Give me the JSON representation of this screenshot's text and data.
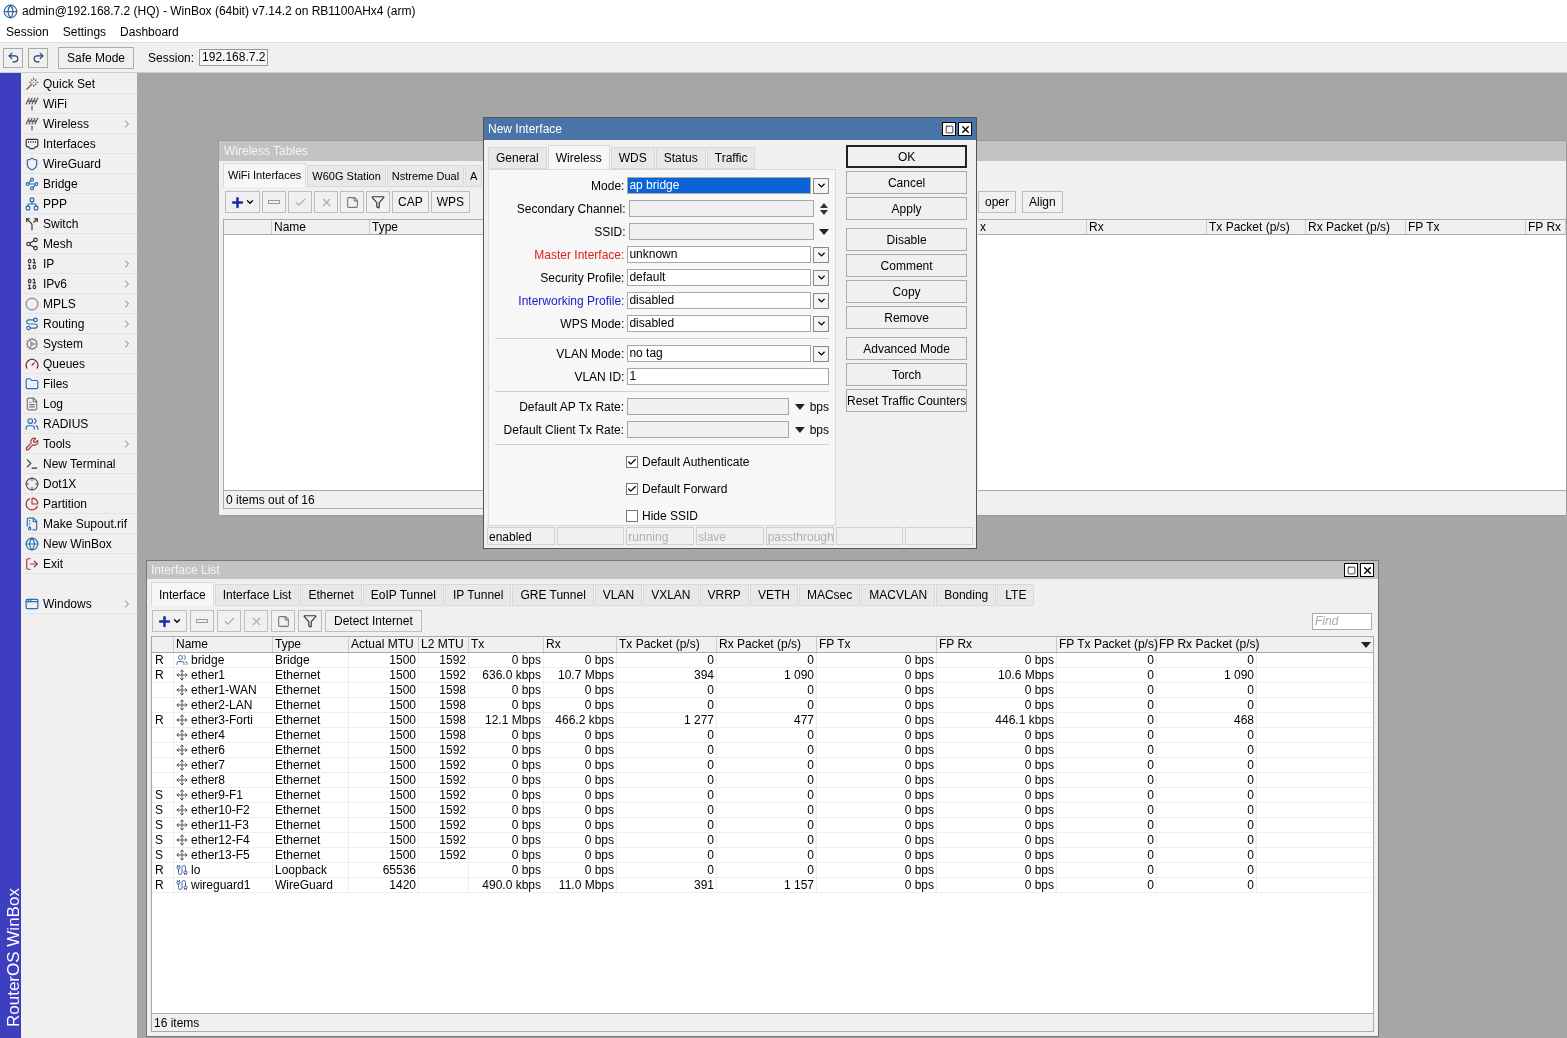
{
  "window": {
    "title": "admin@192.168.7.2 (HQ) - WinBox (64bit) v7.14.2 on RB1100AHx4 (arm)"
  },
  "menu": [
    "Session",
    "Settings",
    "Dashboard"
  ],
  "toolbar": {
    "safe_mode": "Safe Mode",
    "session_label": "Session:",
    "session_value": "192.168.7.2"
  },
  "sidebar": {
    "brand": "RouterOS WinBox",
    "items": [
      {
        "label": "Quick Set",
        "submenu": false
      },
      {
        "label": "WiFi",
        "submenu": false
      },
      {
        "label": "Wireless",
        "submenu": true
      },
      {
        "label": "Interfaces",
        "submenu": false
      },
      {
        "label": "WireGuard",
        "submenu": false
      },
      {
        "label": "Bridge",
        "submenu": false
      },
      {
        "label": "PPP",
        "submenu": false
      },
      {
        "label": "Switch",
        "submenu": false
      },
      {
        "label": "Mesh",
        "submenu": false
      },
      {
        "label": "IP",
        "submenu": true
      },
      {
        "label": "IPv6",
        "submenu": true
      },
      {
        "label": "MPLS",
        "submenu": true
      },
      {
        "label": "Routing",
        "submenu": true
      },
      {
        "label": "System",
        "submenu": true
      },
      {
        "label": "Queues",
        "submenu": false
      },
      {
        "label": "Files",
        "submenu": false
      },
      {
        "label": "Log",
        "submenu": false
      },
      {
        "label": "RADIUS",
        "submenu": false
      },
      {
        "label": "Tools",
        "submenu": true
      },
      {
        "label": "New Terminal",
        "submenu": false
      },
      {
        "label": "Dot1X",
        "submenu": false
      },
      {
        "label": "Partition",
        "submenu": false
      },
      {
        "label": "Make Supout.rif",
        "submenu": false
      },
      {
        "label": "New WinBox",
        "submenu": false
      },
      {
        "label": "Exit",
        "submenu": false
      }
    ],
    "bottom_items": [
      {
        "label": "Windows",
        "submenu": true
      }
    ]
  },
  "wireless_tables": {
    "title": "Wireless Tables",
    "tabs": [
      {
        "label": "WiFi Interfaces",
        "selected": true
      },
      {
        "label": "W60G Station",
        "selected": false
      },
      {
        "label": "Nstreme Dual",
        "selected": false
      },
      {
        "label": "A",
        "selected": false
      }
    ],
    "buttons": [
      "CAP",
      "WPS"
    ],
    "right_buttons": [
      "oper",
      "Align"
    ],
    "columns": [
      "Name",
      "Type"
    ],
    "right_columns": [
      "x",
      "Rx",
      "Tx Packet (p/s)",
      "Rx Packet (p/s)",
      "FP Tx",
      "FP Rx"
    ],
    "status": "0 items out of 16"
  },
  "dialog": {
    "title": "New Interface",
    "tabs": [
      {
        "label": "General",
        "selected": false
      },
      {
        "label": "Wireless",
        "selected": true
      },
      {
        "label": "WDS",
        "selected": false
      },
      {
        "label": "Status",
        "selected": false
      },
      {
        "label": "Traffic",
        "selected": false
      }
    ],
    "groups": [
      [
        {
          "kind": "dropdown",
          "label": "Mode:",
          "value": "ap bridge",
          "selected": true,
          "color": "#000000"
        },
        {
          "kind": "spin",
          "label": "Secondary Channel:",
          "selected": false,
          "color": "#000000"
        },
        {
          "kind": "combo",
          "label": "SSID:",
          "selected": false,
          "color": "#000000"
        },
        {
          "kind": "dropdown",
          "label": "Master Interface:",
          "value": "unknown",
          "selected": false,
          "color": "#e0201c"
        },
        {
          "kind": "dropdown",
          "label": "Security Profile:",
          "value": "default",
          "selected": false,
          "color": "#000000"
        },
        {
          "kind": "dropdown",
          "label": "Interworking Profile:",
          "value": "disabled",
          "selected": false,
          "color": "#2020c8"
        },
        {
          "kind": "dropdown",
          "label": "WPS Mode:",
          "value": "disabled",
          "selected": false,
          "color": "#000000"
        }
      ],
      [
        {
          "kind": "dropdown",
          "label": "VLAN Mode:",
          "value": "no tag",
          "selected": false,
          "color": "#000000"
        },
        {
          "kind": "text",
          "label": "VLAN ID:",
          "value": "1",
          "selected": false,
          "color": "#000000"
        }
      ],
      [
        {
          "kind": "rate",
          "label": "Default AP Tx Rate:",
          "unit": "bps",
          "selected": false,
          "color": "#000000"
        },
        {
          "kind": "rate",
          "label": "Default Client Tx Rate:",
          "unit": "bps",
          "selected": false,
          "color": "#000000"
        }
      ]
    ],
    "checkboxes": [
      {
        "label": "Default Authenticate",
        "checked": true
      },
      {
        "label": "Default Forward",
        "checked": true
      },
      {
        "label": "Hide SSID",
        "checked": false
      }
    ],
    "button_groups": [
      [
        {
          "label": "OK",
          "default": true
        },
        {
          "label": "Cancel",
          "default": false
        },
        {
          "label": "Apply",
          "default": false
        }
      ],
      [
        {
          "label": "Disable",
          "default": false
        },
        {
          "label": "Comment",
          "default": false
        },
        {
          "label": "Copy",
          "default": false
        },
        {
          "label": "Remove",
          "default": false
        }
      ],
      [
        {
          "label": "Advanced Mode",
          "default": false
        },
        {
          "label": "Torch",
          "default": false
        },
        {
          "label": "Reset Traffic Counters",
          "default": false
        }
      ]
    ],
    "status_cells": [
      {
        "kind": "text",
        "text": "enabled",
        "greyed": false
      },
      {
        "kind": "empty"
      },
      {
        "kind": "text",
        "text": "running",
        "greyed": true
      },
      {
        "kind": "text",
        "text": "slave",
        "greyed": true
      },
      {
        "kind": "text",
        "text": "passthrough",
        "greyed": true
      },
      {
        "kind": "empty"
      },
      {
        "kind": "empty"
      }
    ]
  },
  "interface_list": {
    "title": "Interface List",
    "tabs": [
      {
        "label": "Interface",
        "selected": true
      },
      {
        "label": "Interface List",
        "selected": false
      },
      {
        "label": "Ethernet",
        "selected": false
      },
      {
        "label": "EoIP Tunnel",
        "selected": false
      },
      {
        "label": "IP Tunnel",
        "selected": false
      },
      {
        "label": "GRE Tunnel",
        "selected": false
      },
      {
        "label": "VLAN",
        "selected": false
      },
      {
        "label": "VXLAN",
        "selected": false
      },
      {
        "label": "VRRP",
        "selected": false
      },
      {
        "label": "VETH",
        "selected": false
      },
      {
        "label": "MACsec",
        "selected": false
      },
      {
        "label": "MACVLAN",
        "selected": false
      },
      {
        "label": "Bonding",
        "selected": false
      },
      {
        "label": "LTE",
        "selected": false
      }
    ],
    "detect_button": "Detect Internet",
    "find": {
      "placeholder": "Find"
    },
    "columns": [
      "Name",
      "Type",
      "Actual MTU",
      "L2 MTU",
      "Tx",
      "Rx",
      "Tx Packet (p/s)",
      "Rx Packet (p/s)",
      "FP Tx",
      "FP Rx",
      "FP Tx Packet (p/s)",
      "FP Rx Packet (p/s)"
    ],
    "rows": [
      {
        "flag": "R",
        "kind": "bridge",
        "name": "bridge",
        "type": "Bridge",
        "actual_mtu": "1500",
        "l2_mtu": "1592",
        "tx": "0 bps",
        "rx": "0 bps",
        "tx_packet": "0",
        "rx_packet": "0",
        "fp_tx": "0 bps",
        "fp_rx": "0 bps",
        "fp_tx_packet": "0",
        "fp_rx_packet": "0"
      },
      {
        "flag": "R",
        "kind": "ethernet",
        "name": "ether1",
        "type": "Ethernet",
        "actual_mtu": "1500",
        "l2_mtu": "1592",
        "tx": "636.0 kbps",
        "rx": "10.7 Mbps",
        "tx_packet": "394",
        "rx_packet": "1 090",
        "fp_tx": "0 bps",
        "fp_rx": "10.6 Mbps",
        "fp_tx_packet": "0",
        "fp_rx_packet": "1 090"
      },
      {
        "kind": "ethernet",
        "name": "ether1-WAN",
        "type": "Ethernet",
        "actual_mtu": "1500",
        "l2_mtu": "1598",
        "tx": "0 bps",
        "rx": "0 bps",
        "tx_packet": "0",
        "rx_packet": "0",
        "fp_tx": "0 bps",
        "fp_rx": "0 bps",
        "fp_tx_packet": "0",
        "fp_rx_packet": "0"
      },
      {
        "kind": "ethernet",
        "name": "ether2-LAN",
        "type": "Ethernet",
        "actual_mtu": "1500",
        "l2_mtu": "1598",
        "tx": "0 bps",
        "rx": "0 bps",
        "tx_packet": "0",
        "rx_packet": "0",
        "fp_tx": "0 bps",
        "fp_rx": "0 bps",
        "fp_tx_packet": "0",
        "fp_rx_packet": "0"
      },
      {
        "flag": "R",
        "kind": "ethernet",
        "name": "ether3-Forti",
        "type": "Ethernet",
        "actual_mtu": "1500",
        "l2_mtu": "1598",
        "tx": "12.1 Mbps",
        "rx": "466.2 kbps",
        "tx_packet": "1 277",
        "rx_packet": "477",
        "fp_tx": "0 bps",
        "fp_rx": "446.1 kbps",
        "fp_tx_packet": "0",
        "fp_rx_packet": "468"
      },
      {
        "kind": "ethernet",
        "name": "ether4",
        "type": "Ethernet",
        "actual_mtu": "1500",
        "l2_mtu": "1598",
        "tx": "0 bps",
        "rx": "0 bps",
        "tx_packet": "0",
        "rx_packet": "0",
        "fp_tx": "0 bps",
        "fp_rx": "0 bps",
        "fp_tx_packet": "0",
        "fp_rx_packet": "0"
      },
      {
        "kind": "ethernet",
        "name": "ether6",
        "type": "Ethernet",
        "actual_mtu": "1500",
        "l2_mtu": "1592",
        "tx": "0 bps",
        "rx": "0 bps",
        "tx_packet": "0",
        "rx_packet": "0",
        "fp_tx": "0 bps",
        "fp_rx": "0 bps",
        "fp_tx_packet": "0",
        "fp_rx_packet": "0"
      },
      {
        "kind": "ethernet",
        "name": "ether7",
        "type": "Ethernet",
        "actual_mtu": "1500",
        "l2_mtu": "1592",
        "tx": "0 bps",
        "rx": "0 bps",
        "tx_packet": "0",
        "rx_packet": "0",
        "fp_tx": "0 bps",
        "fp_rx": "0 bps",
        "fp_tx_packet": "0",
        "fp_rx_packet": "0"
      },
      {
        "kind": "ethernet",
        "name": "ether8",
        "type": "Ethernet",
        "actual_mtu": "1500",
        "l2_mtu": "1592",
        "tx": "0 bps",
        "rx": "0 bps",
        "tx_packet": "0",
        "rx_packet": "0",
        "fp_tx": "0 bps",
        "fp_rx": "0 bps",
        "fp_tx_packet": "0",
        "fp_rx_packet": "0"
      },
      {
        "flag": "S",
        "kind": "ethernet",
        "name": "ether9-F1",
        "type": "Ethernet",
        "actual_mtu": "1500",
        "l2_mtu": "1592",
        "tx": "0 bps",
        "rx": "0 bps",
        "tx_packet": "0",
        "rx_packet": "0",
        "fp_tx": "0 bps",
        "fp_rx": "0 bps",
        "fp_tx_packet": "0",
        "fp_rx_packet": "0"
      },
      {
        "flag": "S",
        "kind": "ethernet",
        "name": "ether10-F2",
        "type": "Ethernet",
        "actual_mtu": "1500",
        "l2_mtu": "1592",
        "tx": "0 bps",
        "rx": "0 bps",
        "tx_packet": "0",
        "rx_packet": "0",
        "fp_tx": "0 bps",
        "fp_rx": "0 bps",
        "fp_tx_packet": "0",
        "fp_rx_packet": "0"
      },
      {
        "flag": "S",
        "kind": "ethernet",
        "name": "ether11-F3",
        "type": "Ethernet",
        "actual_mtu": "1500",
        "l2_mtu": "1592",
        "tx": "0 bps",
        "rx": "0 bps",
        "tx_packet": "0",
        "rx_packet": "0",
        "fp_tx": "0 bps",
        "fp_rx": "0 bps",
        "fp_tx_packet": "0",
        "fp_rx_packet": "0"
      },
      {
        "flag": "S",
        "kind": "ethernet",
        "name": "ether12-F4",
        "type": "Ethernet",
        "actual_mtu": "1500",
        "l2_mtu": "1592",
        "tx": "0 bps",
        "rx": "0 bps",
        "tx_packet": "0",
        "rx_packet": "0",
        "fp_tx": "0 bps",
        "fp_rx": "0 bps",
        "fp_tx_packet": "0",
        "fp_rx_packet": "0"
      },
      {
        "flag": "S",
        "kind": "ethernet",
        "name": "ether13-F5",
        "type": "Ethernet",
        "actual_mtu": "1500",
        "l2_mtu": "1592",
        "tx": "0 bps",
        "rx": "0 bps",
        "tx_packet": "0",
        "rx_packet": "0",
        "fp_tx": "0 bps",
        "fp_rx": "0 bps",
        "fp_tx_packet": "0",
        "fp_rx_packet": "0"
      },
      {
        "flag": "R",
        "kind": "tunnel",
        "name": "lo",
        "type": "Loopback",
        "actual_mtu": "65536",
        "tx": "0 bps",
        "rx": "0 bps",
        "tx_packet": "0",
        "rx_packet": "0",
        "fp_tx": "0 bps",
        "fp_rx": "0 bps",
        "fp_tx_packet": "0",
        "fp_rx_packet": "0"
      },
      {
        "flag": "R",
        "kind": "tunnel",
        "name": "wireguard1",
        "type": "WireGuard",
        "actual_mtu": "1420",
        "tx": "490.0 kbps",
        "rx": "11.0 Mbps",
        "tx_packet": "391",
        "rx_packet": "1 157",
        "fp_tx": "0 bps",
        "fp_rx": "0 bps",
        "fp_tx_packet": "0",
        "fp_rx_packet": "0"
      }
    ],
    "status": "16 items"
  }
}
